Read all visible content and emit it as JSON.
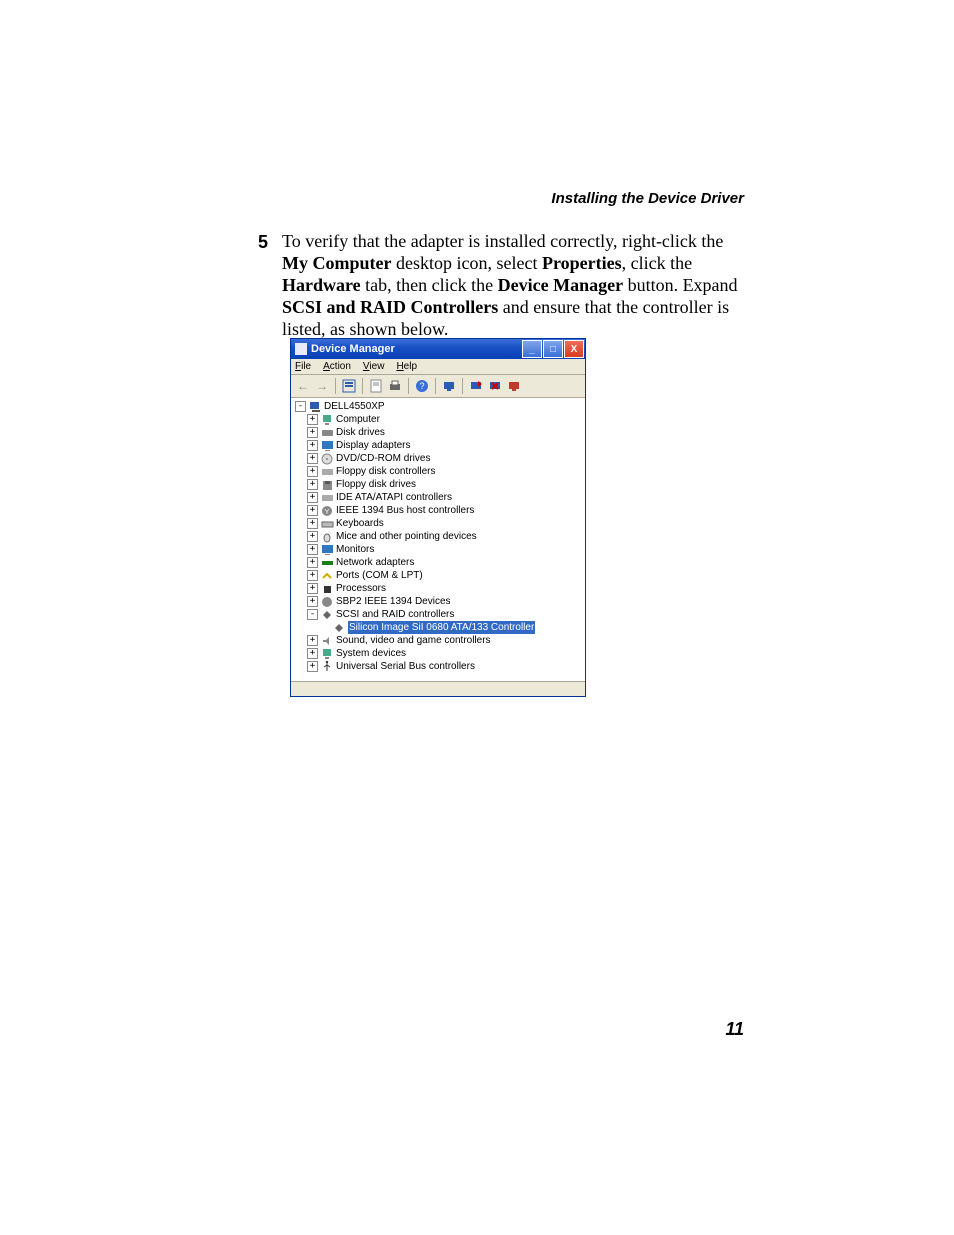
{
  "page": {
    "header_right": "Installing the Device Driver",
    "page_number": "11"
  },
  "step": {
    "number": "5",
    "t1": "To verify that the adapter is installed correctly, right-click the ",
    "b1": "My Computer",
    "t2": " desktop icon, select ",
    "b2": "Properties",
    "t3": ", click the ",
    "b3": "Hardware",
    "t4": " tab, then click the ",
    "b4": "Device Manager",
    "t5": " button. Expand ",
    "b5": "SCSI and RAID Controllers",
    "t6": " and ensure that the controller is listed, as shown below."
  },
  "dm": {
    "title": "Device Manager",
    "menu": {
      "file": "File",
      "action": "Action",
      "view": "View",
      "help": "Help"
    },
    "root": "DELL4550XP",
    "nodes": {
      "computer": "Computer",
      "disk": "Disk drives",
      "display": "Display adapters",
      "dvd": "DVD/CD-ROM drives",
      "fdc": "Floppy disk controllers",
      "fdd": "Floppy disk drives",
      "ide": "IDE ATA/ATAPI controllers",
      "ieee": "IEEE 1394 Bus host controllers",
      "kb": "Keyboards",
      "mouse": "Mice and other pointing devices",
      "mon": "Monitors",
      "net": "Network adapters",
      "ports": "Ports (COM & LPT)",
      "proc": "Processors",
      "sbp2": "SBP2 IEEE 1394 Devices",
      "scsi": "SCSI and RAID controllers",
      "sii": "Silicon Image SiI 0680 ATA/133 Controller",
      "sound": "Sound, video and game controllers",
      "sys": "System devices",
      "usb": "Universal Serial Bus controllers"
    }
  }
}
